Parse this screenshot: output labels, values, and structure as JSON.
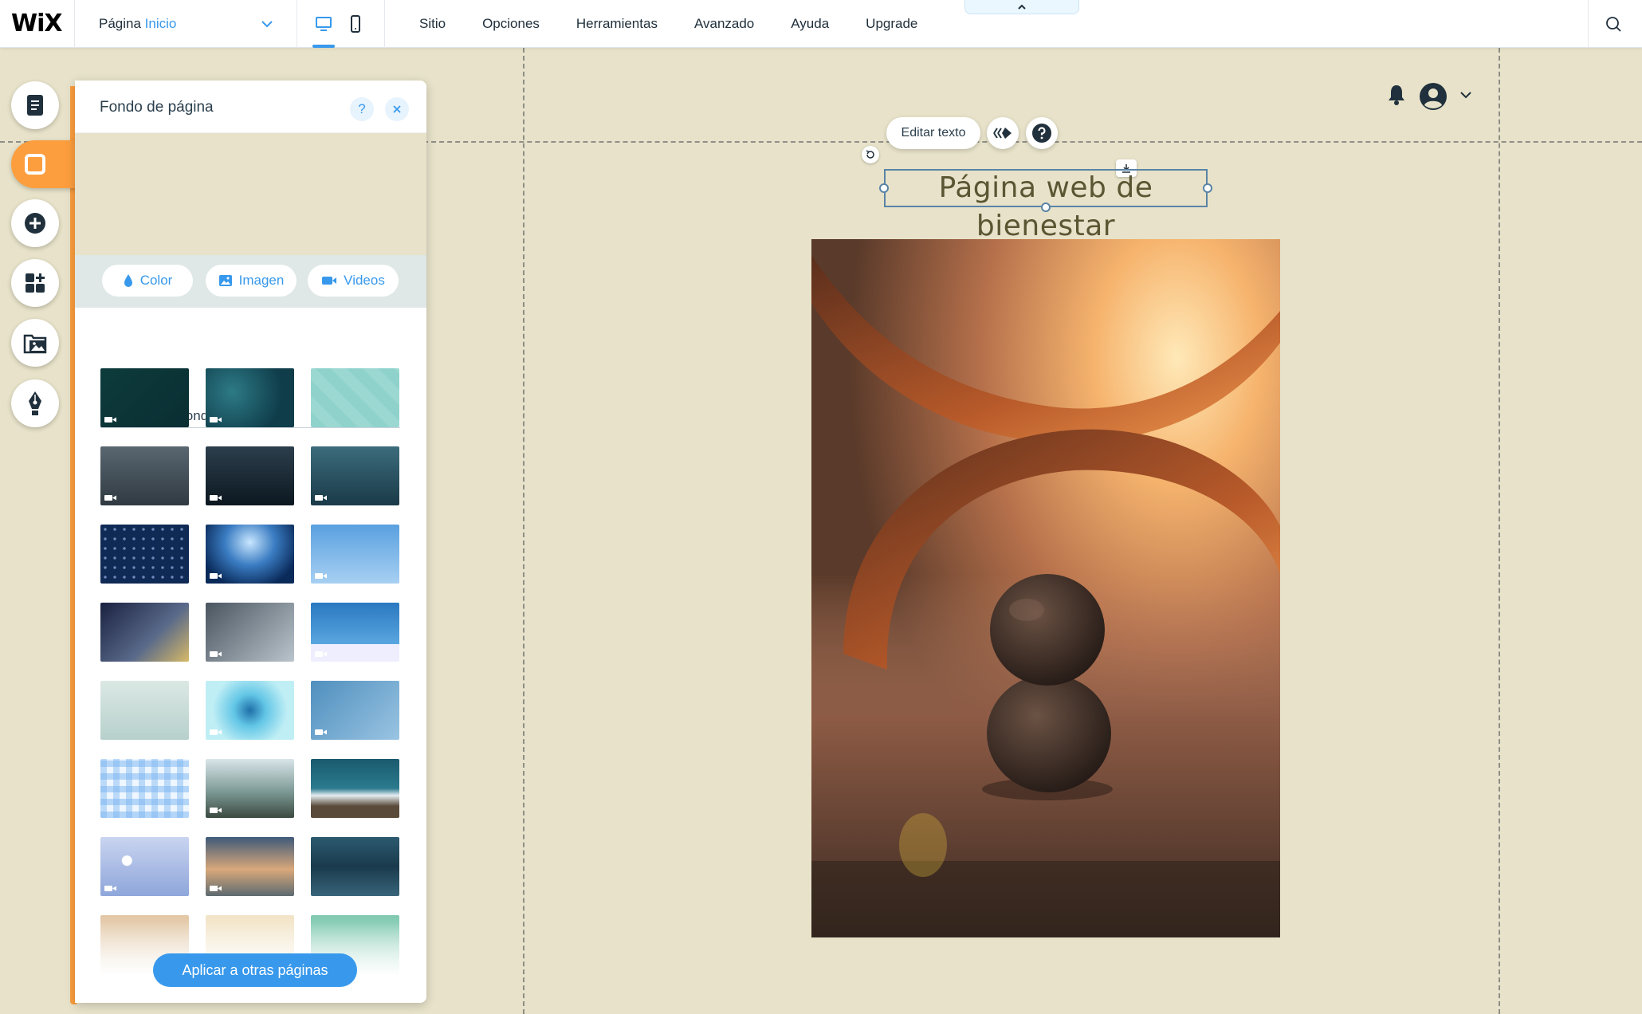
{
  "brand": {
    "logo_text": "WiX"
  },
  "header": {
    "page_label": "Página",
    "page_name": "Inicio",
    "menu": [
      "Sitio",
      "Opciones",
      "Herramientas",
      "Avanzado",
      "Ayuda",
      "Upgrade"
    ]
  },
  "panel": {
    "title": "Fondo de página",
    "tabs": [
      {
        "label": "Color",
        "icon": "drop-icon"
      },
      {
        "label": "Imagen",
        "icon": "image-icon"
      },
      {
        "label": "Videos",
        "icon": "video-camera-icon"
      }
    ],
    "section_label": "Selección de fondos",
    "apply_button": "Aplicar a otras páginas",
    "backgrounds": [
      {
        "kind": "video",
        "desc": "dark-teal"
      },
      {
        "kind": "video",
        "desc": "bubbles-deep"
      },
      {
        "kind": "image",
        "desc": "bananas"
      },
      {
        "kind": "video",
        "desc": "storm-clouds"
      },
      {
        "kind": "video",
        "desc": "dark-water"
      },
      {
        "kind": "video",
        "desc": "underwater-swimmer"
      },
      {
        "kind": "image",
        "desc": "navy-dots"
      },
      {
        "kind": "video",
        "desc": "jellyfish"
      },
      {
        "kind": "video",
        "desc": "palm-sky"
      },
      {
        "kind": "image",
        "desc": "neon-sign"
      },
      {
        "kind": "video",
        "desc": "laptop"
      },
      {
        "kind": "video",
        "desc": "snowboarder"
      },
      {
        "kind": "image",
        "desc": "misty-sea"
      },
      {
        "kind": "video",
        "desc": "water-drop"
      },
      {
        "kind": "video",
        "desc": "blue-sky"
      },
      {
        "kind": "image",
        "desc": "gingham"
      },
      {
        "kind": "video",
        "desc": "mountain-sun"
      },
      {
        "kind": "image",
        "desc": "snow-peaks"
      },
      {
        "kind": "video",
        "desc": "bokeh"
      },
      {
        "kind": "video",
        "desc": "beach-sunset"
      },
      {
        "kind": "image",
        "desc": "ocean-blur"
      },
      {
        "kind": "image",
        "desc": "peach-fog"
      },
      {
        "kind": "image",
        "desc": "cream"
      },
      {
        "kind": "image",
        "desc": "mint"
      }
    ]
  },
  "canvas": {
    "edit_text_button": "Editar texto",
    "heading": "Página web de bienestar"
  },
  "colors": {
    "accent": "#3899ec",
    "active_tool": "#fc9e3e",
    "canvas_bg": "#e7e2c9"
  }
}
